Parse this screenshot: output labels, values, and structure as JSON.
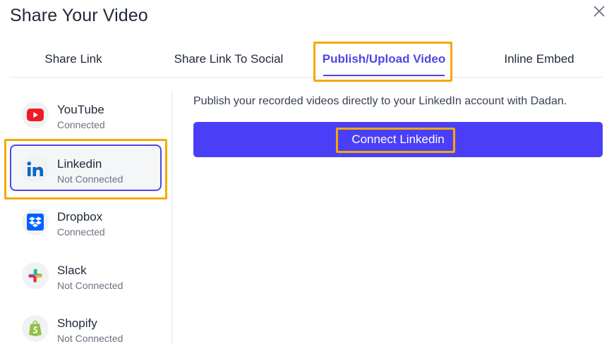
{
  "dialog": {
    "title": "Share Your Video"
  },
  "tabs": [
    {
      "label": "Share Link"
    },
    {
      "label": "Share Link To Social"
    },
    {
      "label": "Publish/Upload Video",
      "active": true
    },
    {
      "label": "Inline Embed"
    }
  ],
  "sidebar": {
    "items": [
      {
        "name": "YouTube",
        "status": "Connected",
        "icon": "youtube-icon"
      },
      {
        "name": "Linkedin",
        "status": "Not Connected",
        "icon": "linkedin-icon",
        "selected": true
      },
      {
        "name": "Dropbox",
        "status": "Connected",
        "icon": "dropbox-icon"
      },
      {
        "name": "Slack",
        "status": "Not Connected",
        "icon": "slack-icon"
      },
      {
        "name": "Shopify",
        "status": "Not Connected",
        "icon": "shopify-icon"
      }
    ]
  },
  "main": {
    "description": "Publish your recorded videos directly to your LinkedIn account with Dadan.",
    "connect_label": "Connect Linkedin"
  },
  "colors": {
    "accent": "#4f46e5",
    "button": "#4a3ff7",
    "highlight": "#f5a800"
  }
}
